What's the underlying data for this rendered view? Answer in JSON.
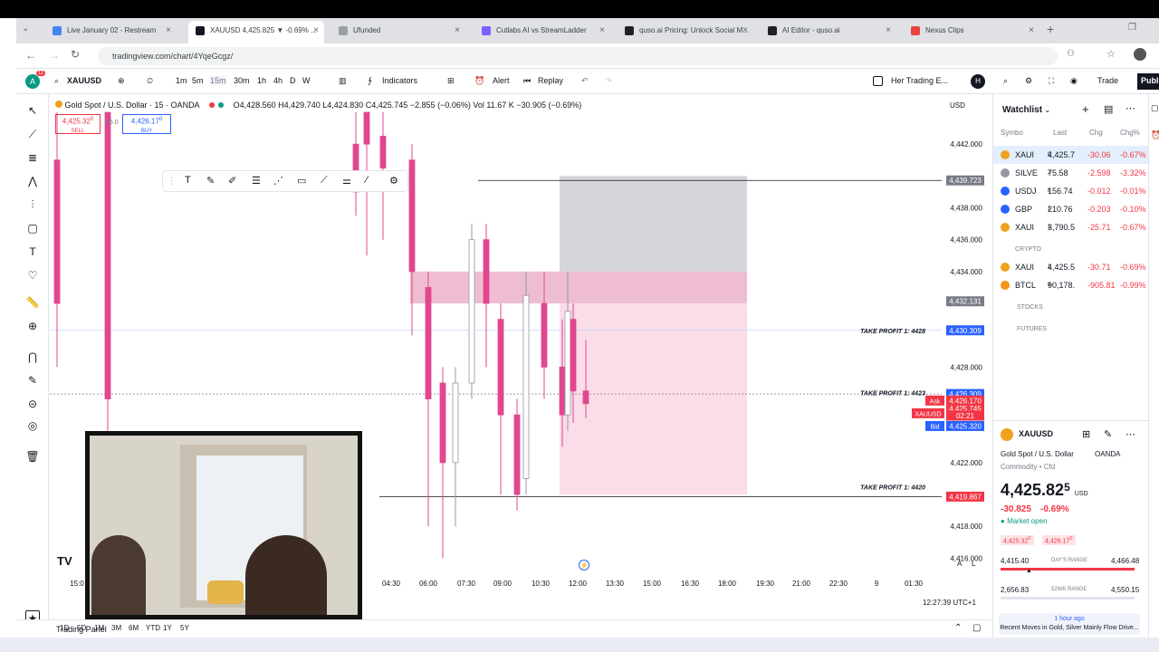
{
  "browser": {
    "tabs": [
      {
        "title": "Live January 02 - Restream",
        "color": "#4285f4"
      },
      {
        "title": "XAUUSD 4,425.825 ▼ -0.69% ...",
        "color": "#131722"
      },
      {
        "title": "Ufunded",
        "color": "#9aa0a6"
      },
      {
        "title": "Cutlabs AI vs StreamLadder",
        "color": "#7b61ff"
      },
      {
        "title": "quso.ai Pricing: Unlock Social M...",
        "color": "#202124"
      },
      {
        "title": "AI Editor - quso.ai",
        "color": "#202124"
      },
      {
        "title": "Nexus Clips",
        "color": "#e8453c"
      }
    ],
    "url": "tradingview.com/chart/4YqeGcgz/",
    "new_tab": "+"
  },
  "toolbar": {
    "symbol": "XAUUSD",
    "intervals": [
      "1m",
      "5m",
      "15m",
      "30m",
      "1h",
      "4h",
      "D",
      "W"
    ],
    "active_interval": "15m",
    "indicators": "Indicators",
    "alert": "Alert",
    "replay": "Replay",
    "layout_name": "Her Trading E...",
    "layout_badge": "H",
    "trade": "Trade",
    "publish": "Publi"
  },
  "legend": {
    "title": "Gold Spot / U.S. Dollar · 15 · OANDA",
    "ohlc": "O4,428.560 H4,429.740 L4,424.830 C4,425.745 −2.855 (−0.06%) Vol 11.67 K −30.905 (−0.69%)",
    "sell_price": "4,425.32",
    "sell_price_sup": "0",
    "sell_label": "SELL",
    "buy_price": "4,426.17",
    "buy_price_sup": "0",
    "buy_label": "BUY",
    "spread": "85.0",
    "currency": "USD"
  },
  "chart_data": {
    "type": "candlestick",
    "symbol": "XAUUSD",
    "y_ticks": [
      4442,
      4438,
      4436,
      4434,
      4428,
      4422,
      4418,
      4416
    ],
    "y_tick_labels": [
      "4,442.000",
      "4,438.000",
      "4,436.000",
      "4,434.000",
      "4,428.000",
      "4,422.000",
      "4,418.000",
      "4,416.000"
    ],
    "x_ticks": [
      "15:0",
      "04:30",
      "06:00",
      "07:30",
      "09:00",
      "10:30",
      "12:00",
      "13:30",
      "15:00",
      "16:30",
      "18:00",
      "19:30",
      "21:00",
      "22:30",
      "9",
      "01:30"
    ],
    "ylim": [
      4415,
      4444
    ],
    "price_labels": [
      {
        "text": "4,439.723",
        "value": 4439.723,
        "color": "#787b86"
      },
      {
        "text": "4,432.131",
        "value": 4432.131,
        "color": "#787b86"
      },
      {
        "text": "4,430.309",
        "value": 4430.309,
        "color": "#2962ff"
      },
      {
        "text": "4,426.309",
        "value": 4426.309,
        "color": "#2962ff"
      },
      {
        "text": "4,426.170",
        "value": 4425.9,
        "color": "#f23645"
      },
      {
        "text": "4,425.745",
        "value": 4425.4,
        "color": "#f23645"
      },
      {
        "text": "02:21",
        "value": 4424.95,
        "color": "#f23645"
      },
      {
        "text": "4,425.320",
        "value": 4424.3,
        "color": "#2962ff"
      },
      {
        "text": "4,419.867",
        "value": 4419.867,
        "color": "#f23645"
      }
    ],
    "side_tags": [
      "Ask",
      "XAUUSD",
      "Bid"
    ],
    "annotations": [
      "TAKE PROFIT 1: 4428",
      "TAKE PROFIT 1: 4423",
      "TAKE PROFIT 1: 4420"
    ],
    "annotation_values": [
      4430.3,
      4426.4,
      4420.5
    ],
    "candles": [
      {
        "o": 4441.0,
        "c": 4432.0,
        "h": 4444.0,
        "l": 4428.0
      },
      {
        "o": 4444.0,
        "c": 4426.0,
        "h": 4444.0,
        "l": 4424.0
      },
      {
        "o": 4442.0,
        "c": 4439.0,
        "h": 4444.0,
        "l": 4437.5
      },
      {
        "o": 4444.0,
        "c": 4442.0,
        "h": 4444.0,
        "l": 4435.0
      },
      {
        "o": 4442.5,
        "c": 4440.5,
        "h": 4444.0,
        "l": 4436.0
      },
      {
        "o": 4441.0,
        "c": 4434.0,
        "h": 4442.0,
        "l": 4430.0
      },
      {
        "o": 4433.0,
        "c": 4426.0,
        "h": 4434.0,
        "l": 4418.0
      },
      {
        "o": 4427.0,
        "c": 4422.0,
        "h": 4428.0,
        "l": 4416.0
      },
      {
        "o": 4422.0,
        "c": 4427.0,
        "h": 4428.0,
        "l": 4418.0
      },
      {
        "o": 4427.0,
        "c": 4436.0,
        "h": 4437.0,
        "l": 4426.0
      },
      {
        "o": 4436.0,
        "c": 4432.0,
        "h": 4437.0,
        "l": 4428.0
      },
      {
        "o": 4431.0,
        "c": 4425.0,
        "h": 4432.0,
        "l": 4420.0
      },
      {
        "o": 4425.0,
        "c": 4420.0,
        "h": 4426.0,
        "l": 4419.0
      },
      {
        "o": 4421.0,
        "c": 4432.5,
        "h": 4434.0,
        "l": 4420.0
      },
      {
        "o": 4432.0,
        "c": 4428.0,
        "h": 4434.0,
        "l": 4426.0
      },
      {
        "o": 4428.0,
        "c": 4425.0,
        "h": 4431.0,
        "l": 4423.0
      },
      {
        "o": 4425.0,
        "c": 4431.5,
        "h": 4434.0,
        "l": 4424.0
      },
      {
        "o": 4431.0,
        "c": 4426.5,
        "h": 4432.0,
        "l": 4424.5
      },
      {
        "o": 4426.5,
        "c": 4425.7,
        "h": 4429.7,
        "l": 4424.8
      }
    ],
    "zones": [
      {
        "kind": "grey",
        "top": 4440.0,
        "bottom": 4434.0
      },
      {
        "kind": "pink-band",
        "top": 4434.0,
        "bottom": 4432.0
      },
      {
        "kind": "pink-light",
        "top": 4432.0,
        "bottom": 4420.0
      }
    ],
    "timestamp": "12:27:39 UTC+1",
    "log_toggle": "A",
    "lin_toggle": "L"
  },
  "watchlist": {
    "title": "Watchlist",
    "columns": [
      "Symbo",
      "Last",
      "Chg",
      "Chg%"
    ],
    "rows": [
      {
        "sym": "XAUI",
        "last": "4,425.7",
        "lastsup": "C",
        "chg": "-30.06",
        "pct": "-0.67%",
        "icon": "#f0a11e",
        "selected": true
      },
      {
        "sym": "SILVE",
        "last": "75.58",
        "lastsup": "2",
        "chg": "-2.598",
        "pct": "-3.32%",
        "icon": "#9598a1"
      },
      {
        "sym": "USDJ",
        "last": "156.74",
        "lastsup": "8",
        "chg": "-0.012",
        "pct": "-0.01%",
        "icon": "#2962ff"
      },
      {
        "sym": "GBP",
        "last": "210.76",
        "lastsup": "1",
        "chg": "-0.203",
        "pct": "-0.10%",
        "icon": "#2962ff"
      },
      {
        "sym": "XAUI",
        "last": "3,790.5",
        "lastsup": "1",
        "chg": "-25.71",
        "pct": "-0.67%",
        "icon": "#f0a11e"
      }
    ],
    "crypto_header": "CRYPTO",
    "crypto_rows": [
      {
        "sym": "XAUI",
        "last": "4,425.5",
        "lastsup": "1",
        "chg": "-30.71",
        "pct": "-0.69%",
        "icon": "#f0a11e"
      },
      {
        "sym": "BTCL",
        "last": "90,178.",
        "lastsup": "8",
        "chg": "-905.81",
        "pct": "-0.99%",
        "icon": "#f7931a"
      }
    ],
    "stocks_header": "STOCKS",
    "futures_header": "FUTURES"
  },
  "details": {
    "symbol": "XAUUSD",
    "name": "Gold Spot / U.S. Dollar",
    "exchange": "OANDA",
    "category": "Commodity • Cfd",
    "price": "4,425.82",
    "price_sup": "5",
    "currency": "USD",
    "change": "-30.825",
    "change_pct": "-0.69%",
    "market_status": "Market open",
    "bid": "4,425.32",
    "bid_sup": "0",
    "ask": "4,426.17",
    "ask_sup": "0",
    "day_low": "4,415.40",
    "day_high": "4,466.48",
    "day_range_label": "DAY'S RANGE",
    "wk_low": "2,656.83",
    "wk_high": "4,550.15",
    "wk_range_label": "52WK RANGE",
    "news_time": "1 hour ago",
    "news_title": "Recent Moves in Gold, Silver Mainly Flow Drive..."
  },
  "bottom": {
    "ranges": [
      "1D",
      "5D",
      "1M",
      "3M",
      "6M",
      "YTD",
      "1Y",
      "5Y"
    ],
    "trading_panel": "Trading Panel",
    "tv_logo": "TV"
  },
  "notification_badge": "11"
}
